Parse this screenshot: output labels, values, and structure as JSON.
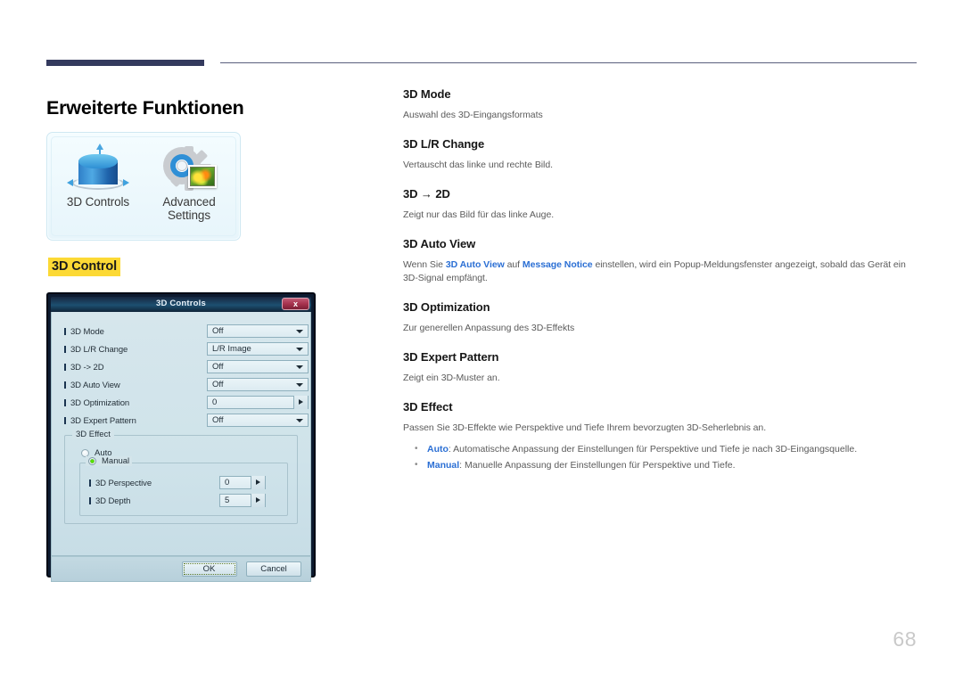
{
  "page": {
    "title": "Erweiterte Funktionen",
    "number": "68",
    "section_label": "3D Control",
    "accent_navy": "#343a5e",
    "highlight_yellow": "#fcd935",
    "keyword_blue": "#2b6fd4"
  },
  "icon_panel": {
    "items": [
      {
        "icon": "3d-cube-icon",
        "label_line1": "3D Controls",
        "label_line2": ""
      },
      {
        "icon": "gear-photo-icon",
        "label_line1": "Advanced",
        "label_line2": "Settings"
      }
    ]
  },
  "dialog": {
    "title": "3D Controls",
    "close_label": "x",
    "rows": [
      {
        "label": "3D Mode",
        "value": "Off",
        "control": "dropdown"
      },
      {
        "label": "3D L/R Change",
        "value": "L/R Image",
        "control": "dropdown"
      },
      {
        "label": "3D -> 2D",
        "value": "Off",
        "control": "dropdown"
      },
      {
        "label": "3D Auto View",
        "value": "Off",
        "control": "dropdown"
      },
      {
        "label": "3D Optimization",
        "value": "0",
        "control": "spinner"
      },
      {
        "label": "3D Expert Pattern",
        "value": "Off",
        "control": "dropdown"
      }
    ],
    "effect_group": {
      "legend": "3D Effect",
      "auto_label": "Auto",
      "auto_selected": false,
      "manual_label": "Manual",
      "manual_selected": true,
      "manual_rows": [
        {
          "label": "3D Perspective",
          "value": "0"
        },
        {
          "label": "3D Depth",
          "value": "5"
        }
      ]
    },
    "buttons": {
      "ok": "OK",
      "cancel": "Cancel"
    }
  },
  "content": {
    "items": [
      {
        "heading": "3D Mode",
        "body": "Auswahl des 3D-Eingangsformats"
      },
      {
        "heading": "3D L/R Change",
        "body": "Vertauscht das linke und rechte Bild."
      },
      {
        "heading": "3D → 2D",
        "body": "Zeigt nur das Bild für das linke Auge."
      },
      {
        "heading": "3D Auto View",
        "body_part1": "Wenn Sie ",
        "keyword1": "3D Auto View",
        "body_part2": " auf ",
        "keyword2": "Message Notice",
        "body_part3": " einstellen, wird ein Popup-Meldungsfenster angezeigt, sobald das Gerät ein 3D-Signal empfängt."
      },
      {
        "heading": "3D Optimization",
        "body": "Zur generellen Anpassung des 3D-Effekts"
      },
      {
        "heading": "3D Expert Pattern",
        "body": "Zeigt ein 3D-Muster an."
      },
      {
        "heading": "3D Effect",
        "body": "Passen Sie 3D-Effekte wie Perspektive und Tiefe Ihrem bevorzugten 3D-Seherlebnis an.",
        "bullets": [
          {
            "keyword": "Auto",
            "text": ": Automatische Anpassung der Einstellungen für Perspektive und Tiefe je nach 3D-Eingangsquelle."
          },
          {
            "keyword": "Manual",
            "text": ": Manuelle Anpassung der Einstellungen für Perspektive und Tiefe."
          }
        ]
      }
    ]
  }
}
